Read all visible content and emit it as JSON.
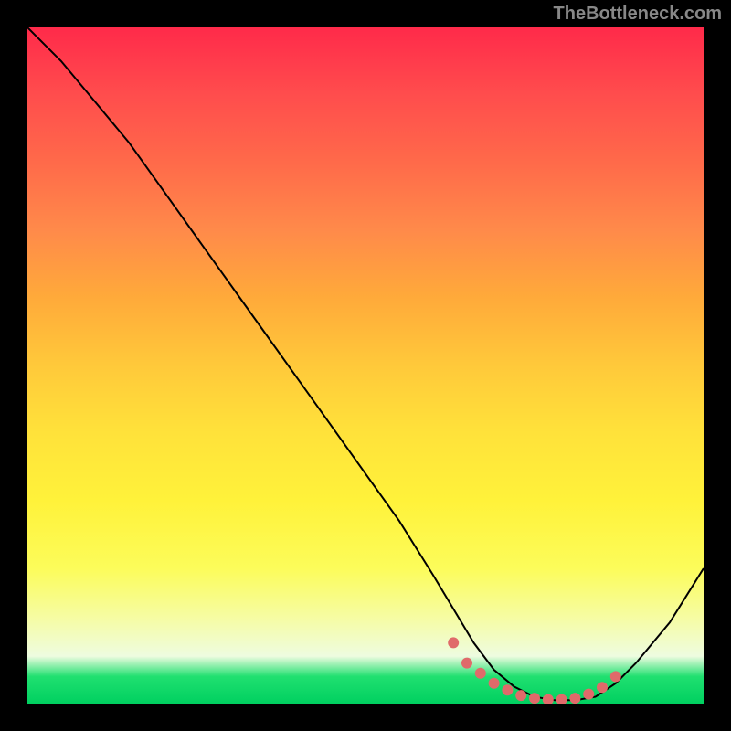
{
  "watermark": "TheBottleneck.com",
  "chart_data": {
    "type": "line",
    "title": "",
    "xlabel": "",
    "ylabel": "",
    "xlim": [
      0,
      100
    ],
    "ylim": [
      0,
      100
    ],
    "series": [
      {
        "name": "curve",
        "color": "#000000",
        "x": [
          0,
          5,
          10,
          15,
          20,
          25,
          30,
          35,
          40,
          45,
          50,
          55,
          60,
          63,
          66,
          69,
          72,
          75,
          78,
          81,
          84,
          87,
          90,
          95,
          100
        ],
        "values": [
          100,
          95,
          89,
          83,
          76,
          69,
          62,
          55,
          48,
          41,
          34,
          27,
          19,
          14,
          9,
          5,
          2.5,
          1,
          0.5,
          0.5,
          1,
          3,
          6,
          12,
          20
        ]
      },
      {
        "name": "highlight-dots",
        "color": "#e06a6a",
        "x": [
          63,
          65,
          67,
          69,
          71,
          73,
          75,
          77,
          79,
          81,
          83,
          85,
          87
        ],
        "values": [
          9,
          6,
          4.5,
          3,
          2,
          1.2,
          0.8,
          0.6,
          0.6,
          0.8,
          1.4,
          2.4,
          4
        ]
      }
    ],
    "gradient_stops": [
      {
        "pos": 0,
        "color": "#ff2a4a"
      },
      {
        "pos": 50,
        "color": "#ffc93a"
      },
      {
        "pos": 85,
        "color": "#fcfc80"
      },
      {
        "pos": 100,
        "color": "#00d060"
      }
    ]
  }
}
